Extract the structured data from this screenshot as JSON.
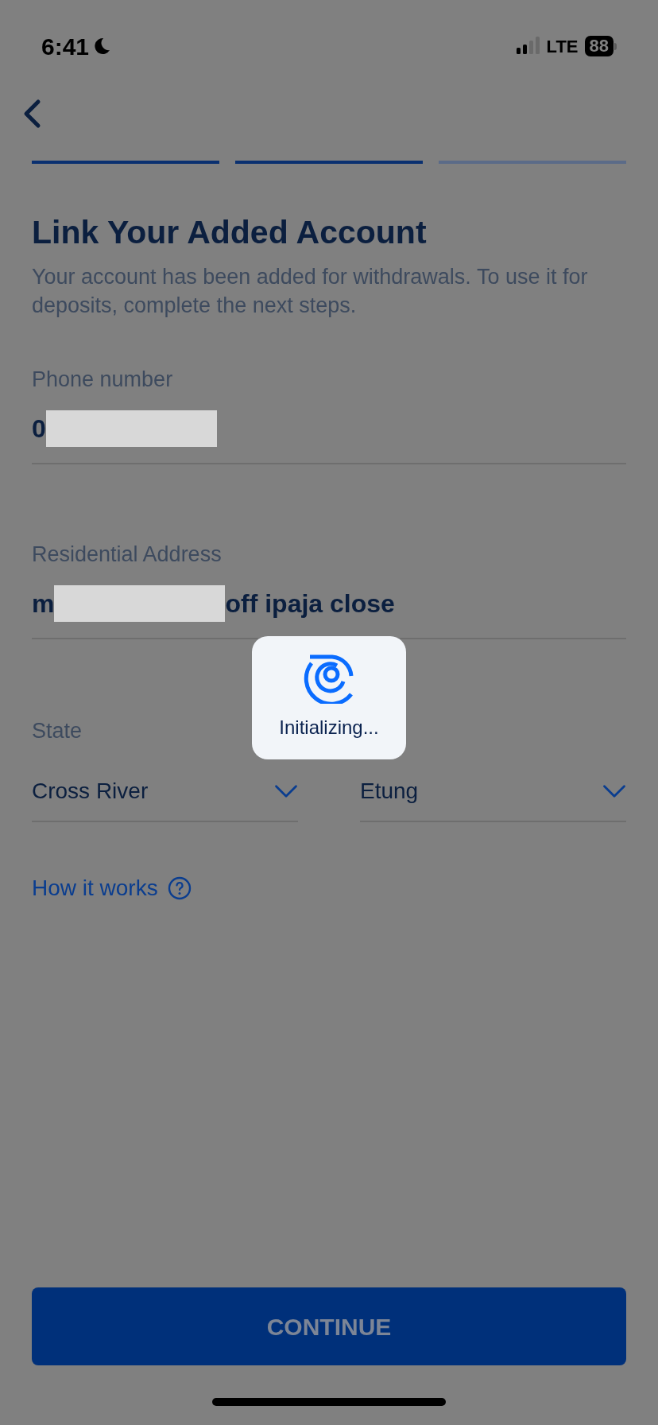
{
  "status_bar": {
    "time": "6:41",
    "network": "LTE",
    "battery": "88"
  },
  "progress_steps": [
    {
      "completed": true
    },
    {
      "completed": true
    },
    {
      "completed": false
    }
  ],
  "title": "Link Your Added Account",
  "subtitle": "Your account has been added for withdrawals. To use it for deposits, complete the next steps.",
  "fields": [
    {
      "label": "Phone number",
      "value_start": "0",
      "redacted": true
    },
    {
      "label": "Residential Address",
      "value_start": "m",
      "redacted": true,
      "value_end": "off ipaja close"
    }
  ],
  "selects": [
    {
      "label": "State",
      "value": "Cross River"
    },
    {
      "value": "Etung"
    }
  ],
  "help_link": "How it works",
  "loading": {
    "message": "Initializing..."
  },
  "continue_button": {
    "label": "CONTINUE",
    "disabled": true
  }
}
